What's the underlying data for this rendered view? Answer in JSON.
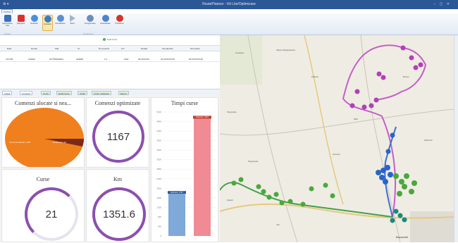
{
  "window": {
    "title": "RoutePlanner - Kit Lite/Optimizare",
    "controls": "– ▢ ✕",
    "quick_access": "⚙ ▾"
  },
  "ribbon": {
    "tab": "Acasa",
    "buttons": [
      {
        "label": "Optimizare rute",
        "color": "#3b6fb6"
      },
      {
        "label": "Ștergere",
        "color": "#d9322e"
      },
      {
        "label": "Selectie",
        "color": "#4a90d9"
      },
      {
        "label": "Cautare",
        "color": "#3d79c2"
      },
      {
        "label": "Vizualizare",
        "color": "#5b8fd0"
      },
      {
        "label": "Start",
        "color": "#a0b4cc"
      },
      {
        "label": "Programare",
        "color": "#6a8fc1"
      },
      {
        "label": "Actualizare",
        "color": "#4a85cf"
      },
      {
        "label": "Închidere",
        "color": "#d8342b"
      }
    ],
    "groups": [
      "Acțiuni",
      "Optimizare"
    ]
  },
  "grid": {
    "caption": "Total curse",
    "columns": [
      "Data",
      "Numar",
      "Stat",
      "Id",
      "Nr.comenzi",
      "Km",
      "Durata",
      "Ora plecare",
      "Ora sosire"
    ],
    "rows": [
      {
        "values": [
          "1/07/08",
          "100064",
          "OPTIMIZARE1",
          "403848",
          "1.2",
          "1001",
          "00:00:00:00",
          "01:00:00:00:00",
          "00:00:00:00:00"
        ]
      }
    ]
  },
  "tabs": [
    "Acasa",
    "Comenzi",
    "Curse",
    "Harta curse",
    "Grafic",
    "Curse nealocate",
    "Export"
  ],
  "dashboard": {
    "pie": {
      "title": "Comenzi alocate si nea...",
      "slice_big": "Comenzi alocate: 1167",
      "slice_small": "Nealocate: 32"
    },
    "optimized": {
      "title": "Comenzi optimizate",
      "value": "1167"
    },
    "times": {
      "title": "Timpi curse",
      "bar1_label": "Estimare: 1767",
      "bar2_label": "Realizare: 4921"
    },
    "trucks": {
      "title": "Curse",
      "value": "21"
    },
    "km": {
      "title": "Km",
      "value": "1351.6"
    }
  },
  "chart_data": {
    "type": "bar",
    "title": "Timpi curse",
    "categories": [
      "Estimare",
      "Realizare"
    ],
    "values": [
      1767,
      4921
    ],
    "ylim": [
      0,
      5200
    ],
    "colors": [
      "#7ea9d8",
      "#f08b93"
    ]
  },
  "map": {
    "cities": [
      "Ploiesti",
      "Buzau",
      "Targoviste",
      "Pitesti",
      "Slobozia",
      "Urziceni",
      "Bucuresti",
      "Giurgiu",
      "Campina",
      "Valea Calugareasca",
      "Mizil",
      "Pogoanele",
      "Titu",
      "Gaesti",
      "Oltenita"
    ]
  }
}
